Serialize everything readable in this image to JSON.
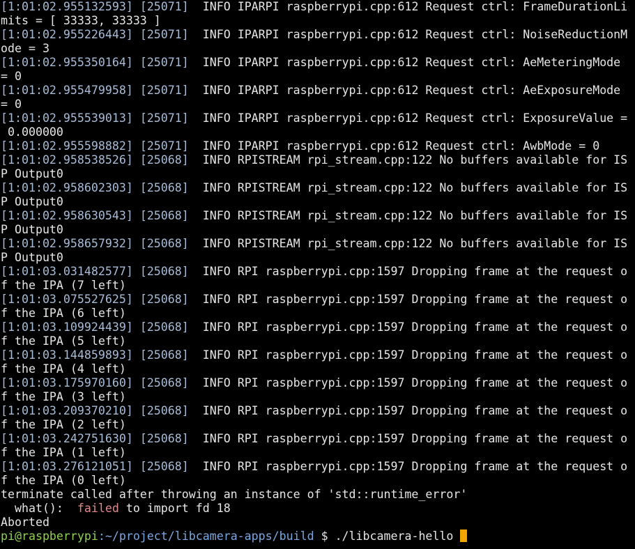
{
  "terminal": {
    "log": [
      {
        "ts": "[1:01:02.955132593]",
        "pid": "[25071]",
        "text": "  INFO IPARPI raspberrypi.cpp:612 Request ctrl: FrameDurationLi",
        "cont": "mits = [ 33333, 33333 ]"
      },
      {
        "ts": "[1:01:02.955226443]",
        "pid": "[25071]",
        "text": "  INFO IPARPI raspberrypi.cpp:612 Request ctrl: NoiseReductionM",
        "cont": "ode = 3"
      },
      {
        "ts": "[1:01:02.955350164]",
        "pid": "[25071]",
        "text": "  INFO IPARPI raspberrypi.cpp:612 Request ctrl: AeMeteringMode",
        "cont": "= 0"
      },
      {
        "ts": "[1:01:02.955479958]",
        "pid": "[25071]",
        "text": "  INFO IPARPI raspberrypi.cpp:612 Request ctrl: AeExposureMode",
        "cont": "= 0"
      },
      {
        "ts": "[1:01:02.955539013]",
        "pid": "[25071]",
        "text": "  INFO IPARPI raspberrypi.cpp:612 Request ctrl: ExposureValue =",
        "cont": " 0.000000"
      },
      {
        "ts": "[1:01:02.955598882]",
        "pid": "[25071]",
        "text": "  INFO IPARPI raspberrypi.cpp:612 Request ctrl: AwbMode = 0",
        "cont": null
      },
      {
        "ts": "[1:01:02.958538526]",
        "pid": "[25068]",
        "text": "  INFO RPISTREAM rpi_stream.cpp:122 No buffers available for IS",
        "cont": "P Output0"
      },
      {
        "ts": "[1:01:02.958602303]",
        "pid": "[25068]",
        "text": "  INFO RPISTREAM rpi_stream.cpp:122 No buffers available for IS",
        "cont": "P Output0"
      },
      {
        "ts": "[1:01:02.958630543]",
        "pid": "[25068]",
        "text": "  INFO RPISTREAM rpi_stream.cpp:122 No buffers available for IS",
        "cont": "P Output0"
      },
      {
        "ts": "[1:01:02.958657932]",
        "pid": "[25068]",
        "text": "  INFO RPISTREAM rpi_stream.cpp:122 No buffers available for IS",
        "cont": "P Output0"
      },
      {
        "ts": "[1:01:03.031482577]",
        "pid": "[25068]",
        "text": "  INFO RPI raspberrypi.cpp:1597 Dropping frame at the request o",
        "cont": "f the IPA (7 left)"
      },
      {
        "ts": "[1:01:03.075527625]",
        "pid": "[25068]",
        "text": "  INFO RPI raspberrypi.cpp:1597 Dropping frame at the request o",
        "cont": "f the IPA (6 left)"
      },
      {
        "ts": "[1:01:03.109924439]",
        "pid": "[25068]",
        "text": "  INFO RPI raspberrypi.cpp:1597 Dropping frame at the request o",
        "cont": "f the IPA (5 left)"
      },
      {
        "ts": "[1:01:03.144859893]",
        "pid": "[25068]",
        "text": "  INFO RPI raspberrypi.cpp:1597 Dropping frame at the request o",
        "cont": "f the IPA (4 left)"
      },
      {
        "ts": "[1:01:03.175970160]",
        "pid": "[25068]",
        "text": "  INFO RPI raspberrypi.cpp:1597 Dropping frame at the request o",
        "cont": "f the IPA (3 left)"
      },
      {
        "ts": "[1:01:03.209370210]",
        "pid": "[25068]",
        "text": "  INFO RPI raspberrypi.cpp:1597 Dropping frame at the request o",
        "cont": "f the IPA (2 left)"
      },
      {
        "ts": "[1:01:03.242751630]",
        "pid": "[25068]",
        "text": "  INFO RPI raspberrypi.cpp:1597 Dropping frame at the request o",
        "cont": "f the IPA (1 left)"
      },
      {
        "ts": "[1:01:03.276121051]",
        "pid": "[25068]",
        "text": "  INFO RPI raspberrypi.cpp:1597 Dropping frame at the request o",
        "cont": "f the IPA (0 left)"
      }
    ],
    "terminate_line": "terminate called after throwing an instance of 'std::runtime_error'",
    "what_prefix": "  what():  ",
    "what_failed": "failed",
    "what_rest": " to import fd 18",
    "aborted": "Aborted",
    "prompt": {
      "user_host": "pi@raspberrypi",
      "path": ":~/project/libcamera-apps/build",
      "symbol": " $ ",
      "command": "./libcamera-hello "
    }
  },
  "colors": {
    "background": "#000000",
    "timestamp": "#a8bcd8",
    "text": "#e6e6e6",
    "error": "#e08a8a",
    "prompt_user": "#8fd14f",
    "prompt_path": "#7ba7e0",
    "cursor": "#f0a500"
  }
}
